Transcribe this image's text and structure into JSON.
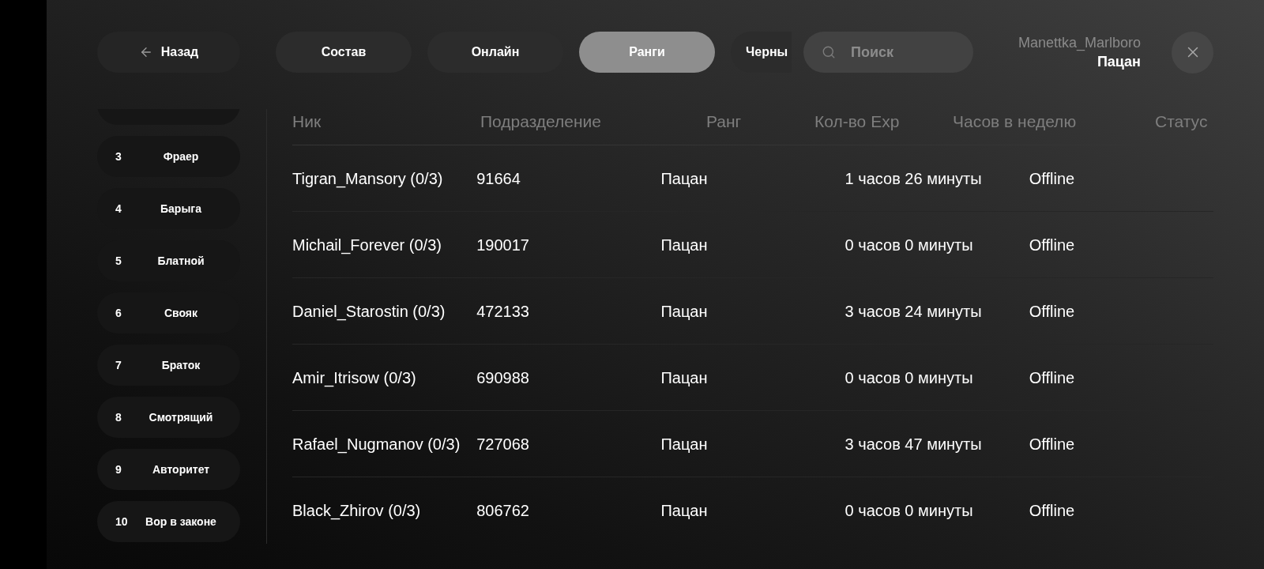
{
  "back_button": {
    "label": "Назад"
  },
  "tabs": [
    {
      "label": "Состав",
      "selected": false,
      "cut_off": false
    },
    {
      "label": "Онлайн",
      "selected": false,
      "cut_off": false
    },
    {
      "label": "Ранги",
      "selected": true,
      "cut_off": false
    },
    {
      "label": "Черны",
      "selected": false,
      "cut_off": true
    }
  ],
  "search": {
    "placeholder": "Поиск"
  },
  "user": {
    "name": "Manettka_Marlboro",
    "rank": "Пацан"
  },
  "ranks": [
    {
      "number": "3",
      "name": "Фраер"
    },
    {
      "number": "4",
      "name": "Барыга"
    },
    {
      "number": "5",
      "name": "Блатной"
    },
    {
      "number": "6",
      "name": "Свояк"
    },
    {
      "number": "7",
      "name": "Браток"
    },
    {
      "number": "8",
      "name": "Смотрящий"
    },
    {
      "number": "9",
      "name": "Авторитет"
    },
    {
      "number": "10",
      "name": "Вор в законе"
    }
  ],
  "table": {
    "columns": [
      "Ник",
      "Подразделение",
      "Ранг",
      "Кол-во Exp",
      "Часов в неделю",
      "Статус"
    ],
    "rows": [
      {
        "cells": [
          "Tigran_Mansory (0/3)",
          "91664",
          "Пацан",
          "1 часов 26 минуты",
          "Offline"
        ]
      },
      {
        "cells": [
          "Michail_Forever (0/3)",
          "190017",
          "Пацан",
          "0 часов 0 минуты",
          "Offline"
        ]
      },
      {
        "cells": [
          "Daniel_Starostin (0/3)",
          "472133",
          "Пацан",
          "3 часов 24 минуты",
          "Offline"
        ]
      },
      {
        "cells": [
          "Amir_Itrisow (0/3)",
          "690988",
          "Пацан",
          "0 часов 0 минуты",
          "Offline"
        ]
      },
      {
        "cells": [
          "Rafael_Nugmanov (0/3)",
          "727068",
          "Пацан",
          "3 часов 47 минуты",
          "Offline"
        ]
      },
      {
        "cells": [
          "Black_Zhirov (0/3)",
          "806762",
          "Пацан",
          "0 часов 0 минуты",
          "Offline"
        ]
      }
    ]
  }
}
